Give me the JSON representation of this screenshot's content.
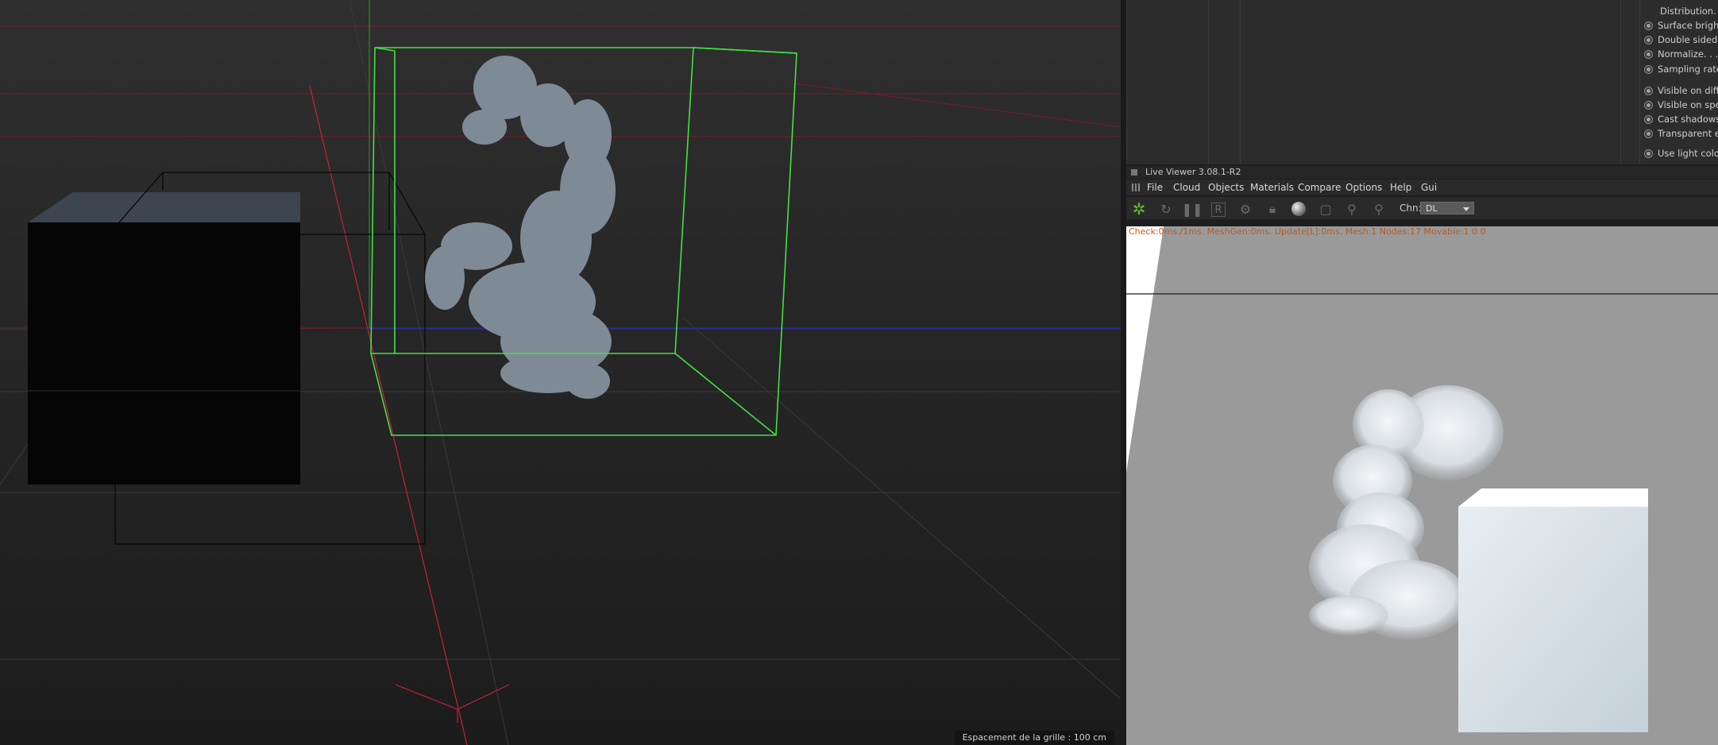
{
  "viewport": {
    "grid_spacing_label": "Espacement de la grille : 100 cm"
  },
  "attributes": {
    "options": [
      {
        "label": "Distribution. . . ."
      },
      {
        "label": "Surface bright"
      },
      {
        "label": "Double sided. ."
      },
      {
        "label": "Normalize. . . . ."
      },
      {
        "label": "Sampling rate"
      },
      {
        "label": "Visible on diff"
      },
      {
        "label": "Visible on spec"
      },
      {
        "label": "Cast shadows"
      },
      {
        "label": "Transparent er"
      },
      {
        "label": "Use light color"
      }
    ]
  },
  "live_viewer": {
    "title": "Live Viewer 3.08.1-R2",
    "menu": [
      "File",
      "Cloud",
      "Objects",
      "Materials",
      "Compare",
      "Options",
      "Help",
      "Gui"
    ],
    "channel_label": "Chn:",
    "channel_value": "DL",
    "status": "Check:0ms./1ms. MeshGen:0ms. Update[L]:0ms. Mesh:1 Nodes:17 Movable:1  0 0",
    "toolbar_icons": [
      "octane-logo-icon",
      "refresh-icon",
      "pause-icon",
      "region-render-icon",
      "settings-gear-icon",
      "lock-icon",
      "material-ball-icon",
      "clay-mode-icon",
      "pick-focus-icon",
      "pick-white-balance-icon"
    ],
    "colors": {
      "status_text": "#b85a22",
      "selection_box": "#44e044",
      "axis_red": "#c8203a",
      "axis_blue": "#2020c8"
    }
  }
}
